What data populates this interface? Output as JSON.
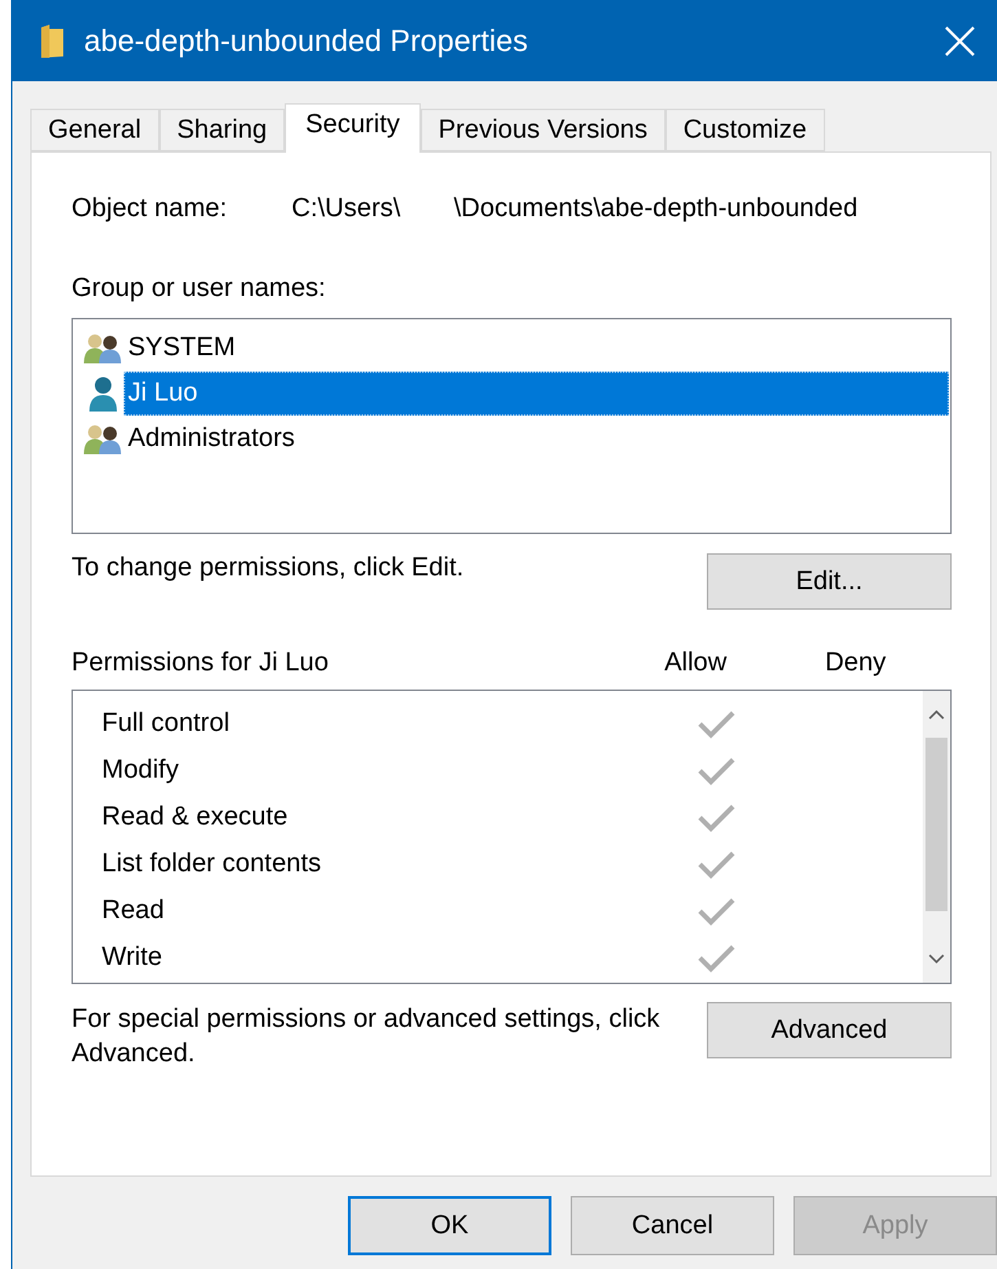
{
  "window": {
    "title": "abe-depth-unbounded Properties"
  },
  "tabs": [
    {
      "label": "General",
      "selected": false
    },
    {
      "label": "Sharing",
      "selected": false
    },
    {
      "label": "Security",
      "selected": true
    },
    {
      "label": "Previous Versions",
      "selected": false
    },
    {
      "label": "Customize",
      "selected": false
    }
  ],
  "object_name": {
    "label": "Object name:",
    "path_start": "C:\\Users\\",
    "path_end": "\\Documents\\abe-depth-unbounded"
  },
  "groups": {
    "label": "Group or user names:",
    "items": [
      {
        "name": "SYSTEM",
        "kind": "group",
        "selected": false
      },
      {
        "name": "Ji Luo",
        "kind": "user",
        "selected": true
      },
      {
        "name": "Administrators",
        "kind": "group",
        "selected": false
      }
    ]
  },
  "change_hint": "To change permissions, click Edit.",
  "edit_button": "Edit...",
  "permissions": {
    "label": "Permissions for Ji Luo",
    "allow_header": "Allow",
    "deny_header": "Deny",
    "rows": [
      {
        "name": "Full control",
        "allow": true,
        "deny": false
      },
      {
        "name": "Modify",
        "allow": true,
        "deny": false
      },
      {
        "name": "Read & execute",
        "allow": true,
        "deny": false
      },
      {
        "name": "List folder contents",
        "allow": true,
        "deny": false
      },
      {
        "name": "Read",
        "allow": true,
        "deny": false
      },
      {
        "name": "Write",
        "allow": true,
        "deny": false
      }
    ]
  },
  "advanced_hint": "For special permissions or advanced settings, click Advanced.",
  "advanced_button": "Advanced",
  "buttons": [
    {
      "label": "OK",
      "default": true,
      "disabled": false
    },
    {
      "label": "Cancel",
      "default": false,
      "disabled": false
    },
    {
      "label": "Apply",
      "default": false,
      "disabled": true
    }
  ]
}
